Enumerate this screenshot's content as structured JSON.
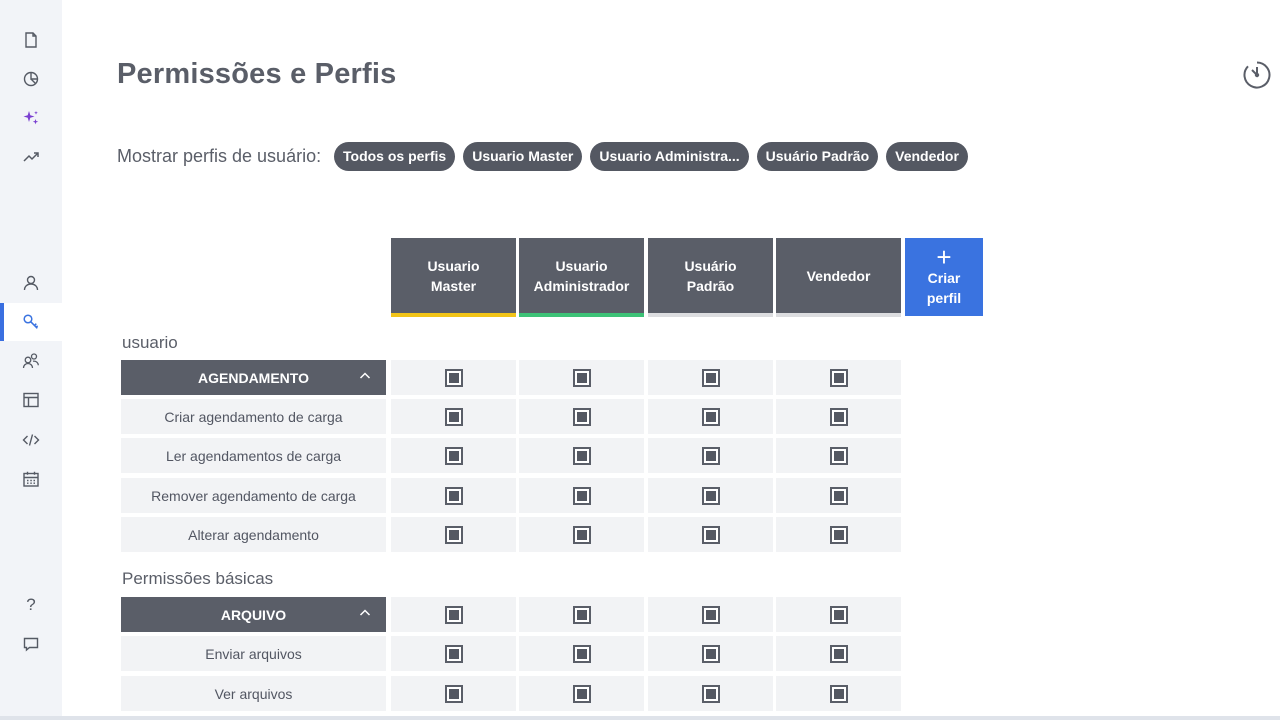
{
  "sidebar": {
    "icons": [
      "document-icon",
      "pie-chart-icon",
      "sparkle-icon",
      "trend-icon",
      "user-icon",
      "key-icon",
      "users-icon",
      "layout-icon",
      "code-icon",
      "calendar-icon",
      "help-icon",
      "chat-icon"
    ],
    "active": "key-icon",
    "help_glyph": "?"
  },
  "page": {
    "title": "Permissões e Perfis"
  },
  "filter": {
    "label": "Mostrar perfis de usuário:",
    "chips": [
      "Todos os perfis",
      "Usuario Master",
      "Usuario Administra...",
      "Usuário Padrão",
      "Vendedor"
    ]
  },
  "profiles": [
    {
      "line1": "Usuario",
      "line2": "Master",
      "accent": "#f2c418"
    },
    {
      "line1": "Usuario",
      "line2": "Administrador",
      "accent": "#3dc277"
    },
    {
      "line1": "Usuário",
      "line2": "Padrão",
      "accent": "#dcdde0"
    },
    {
      "line1": "Vendedor",
      "line2": "",
      "accent": "#dcdde0"
    }
  ],
  "create_profile": {
    "plus": "+",
    "line1": "Criar",
    "line2": "perfil"
  },
  "sections": [
    {
      "label": "usuario",
      "group": "AGENDAMENTO",
      "rows": [
        "Criar agendamento de carga",
        "Ler agendamentos de carga",
        "Remover agendamento de carga",
        "Alterar agendamento"
      ]
    },
    {
      "label": "Permissões básicas",
      "group": "ARQUIVO",
      "rows": [
        "Enviar arquivos",
        "Ver arquivos"
      ]
    }
  ],
  "colors": {
    "accent_blue": "#3a73e0",
    "header_gray": "#5a5e68"
  }
}
